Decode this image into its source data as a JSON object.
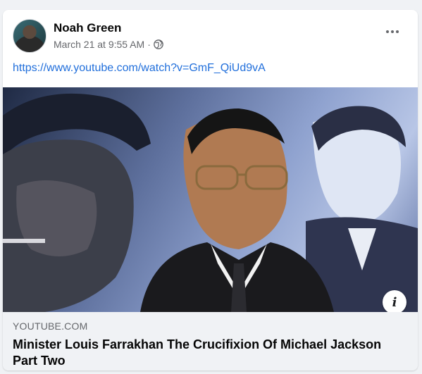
{
  "post": {
    "author": "Noah Green",
    "timestamp": "March 21 at 9:55 AM",
    "separator": "·",
    "privacy_icon": "globe-icon",
    "more_icon": "more-horizontal-icon",
    "link_url": "https://www.youtube.com/watch?v=GmF_QiUd9vA"
  },
  "preview": {
    "domain": "YOUTUBE.COM",
    "title": "Minister Louis Farrakhan The Crucifixion Of Michael Jackson Part Two",
    "info_icon": "info-icon",
    "info_glyph": "i"
  }
}
